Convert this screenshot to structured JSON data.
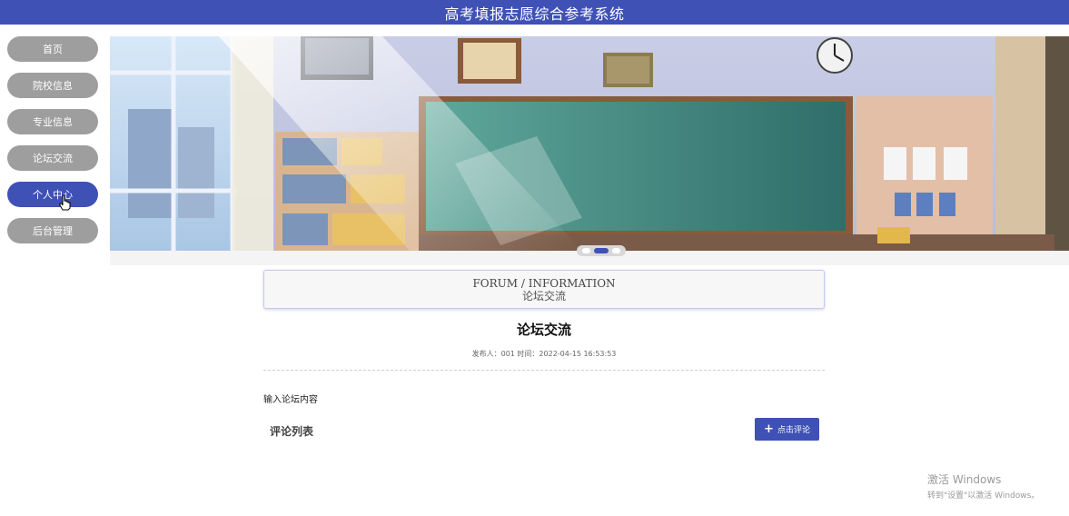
{
  "header": {
    "title": "高考填报志愿综合参考系统"
  },
  "sidebar": {
    "items": [
      {
        "label": "首页",
        "active": false
      },
      {
        "label": "院校信息",
        "active": false
      },
      {
        "label": "专业信息",
        "active": false
      },
      {
        "label": "论坛交流",
        "active": false
      },
      {
        "label": "个人中心",
        "active": true
      },
      {
        "label": "后台管理",
        "active": false
      }
    ]
  },
  "carousel": {
    "slide_count": 3,
    "active_index": 1
  },
  "section": {
    "title_en": "FORUM / INFORMATION",
    "title_cn": "论坛交流"
  },
  "post": {
    "title": "论坛交流",
    "meta": "发布人：001 时间：2022-04-15 16:53:53",
    "content": "输入论坛内容"
  },
  "comments": {
    "label": "评论列表",
    "button_label": "点击评论"
  },
  "watermark": {
    "line1": "激活 Windows",
    "line2": "转到\"设置\"以激活 Windows。"
  },
  "colors": {
    "accent": "#3f51b5",
    "inactive_nav": "#9e9e9e"
  }
}
